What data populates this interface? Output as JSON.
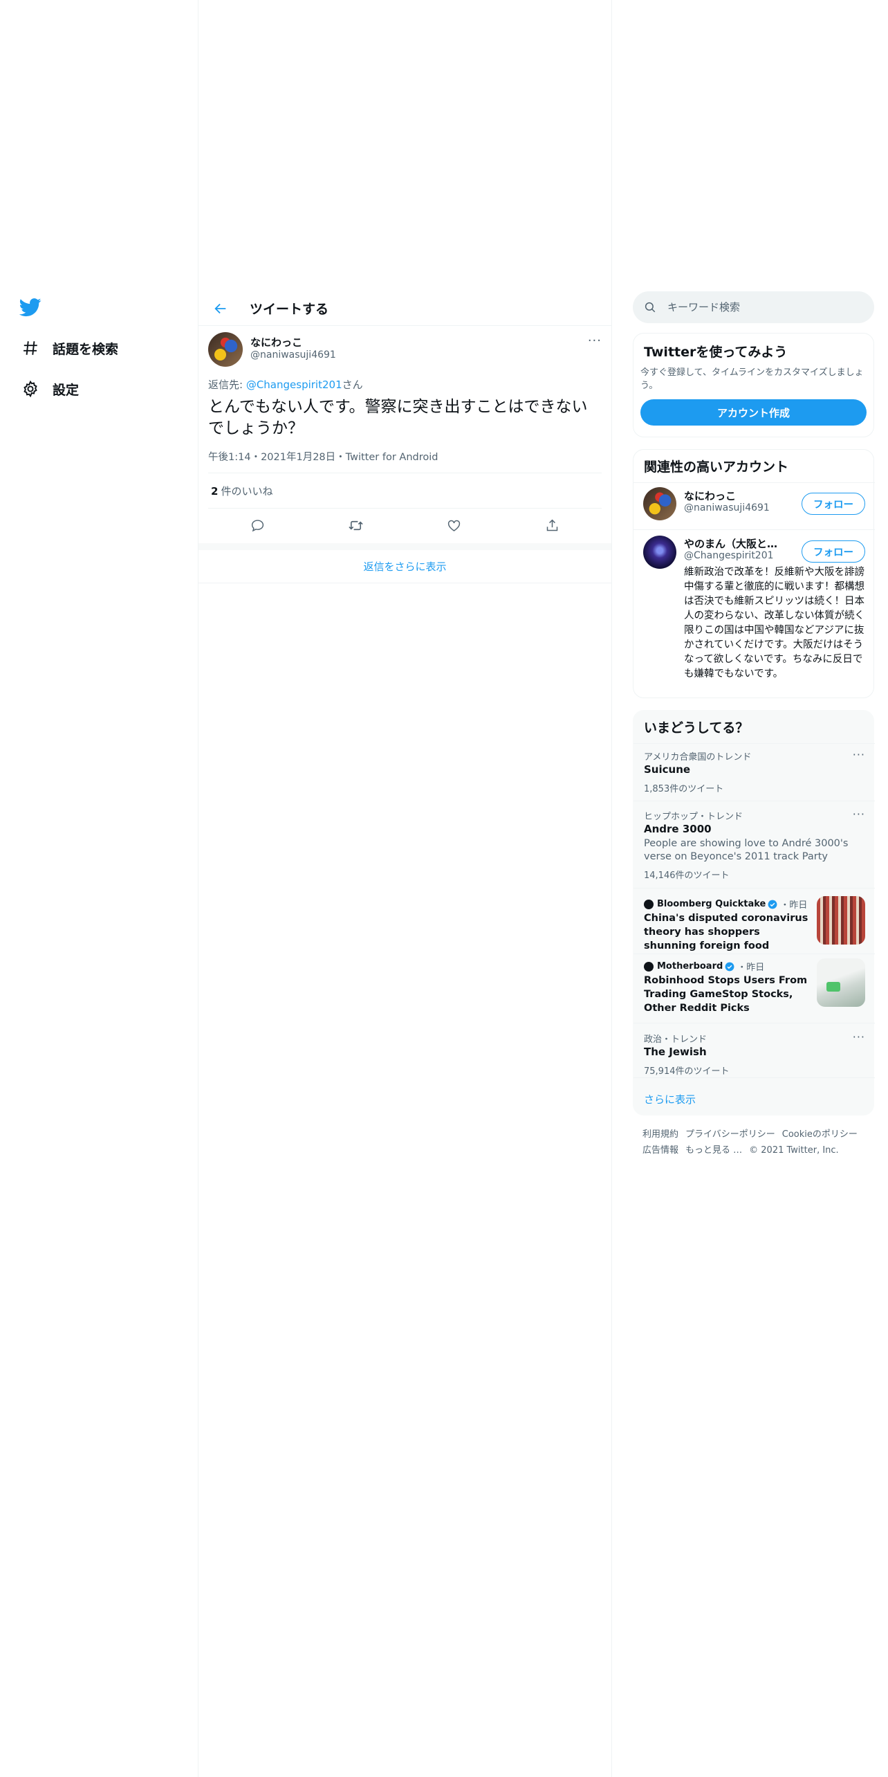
{
  "nav": {
    "explore_label": "話題を検索",
    "settings_label": "設定"
  },
  "header": {
    "title": "ツイートする"
  },
  "tweet": {
    "display_name": "なにわっこ",
    "handle": "@naniwasuji4691",
    "reply_prefix": "返信先: ",
    "reply_mention": "@Changespirit201",
    "reply_suffix": "さん",
    "text": "とんでもない人です。警察に突き出すことはできないでしょうか？",
    "time": "午後1:14",
    "date": "2021年1月28日",
    "source": "Twitter for Android",
    "meta_sep": "・",
    "like_count": "2",
    "like_label": "件のいいね",
    "show_more_replies": "返信をさらに表示"
  },
  "search": {
    "placeholder": "キーワード検索"
  },
  "signup": {
    "title": "Twitterを使ってみよう",
    "description": "今すぐ登録して、タイムラインをカスタマイズしましょう。",
    "button": "アカウント作成"
  },
  "relevant": {
    "title": "関連性の高いアカウント",
    "follow_label": "フォロー",
    "accounts": [
      {
        "name": "なにわっこ",
        "handle": "@naniwasuji4691",
        "bio": ""
      },
      {
        "name": "やのまん（大阪と維...",
        "handle": "@Changespirit201",
        "bio": "維新政治で改革を！反維新や大阪を誹謗中傷する輩と徹底的に戦います！都構想は否決でも維新スピリッツは続く！日本人の変わらない、改革しない体質が続く限りこの国は中国や韓国などアジアに抜かされていくだけです。大阪だけはそうなって欲しくないです。ちなみに反日でも嫌韓でもないです。"
      }
    ]
  },
  "trends": {
    "title": "いまどうしてる？",
    "items": [
      {
        "context": "アメリカ合衆国のトレンド",
        "name": "Suicune",
        "description": "",
        "count": "1,853件のツイート"
      },
      {
        "context": "ヒップホップ・トレンド",
        "name": "Andre 3000",
        "description": "People are showing love to André 3000's verse on Beyonce's 2011 track Party",
        "count": "14,146件のツイート"
      },
      {
        "context": "政治・トレンド",
        "name": "The Jewish",
        "description": "",
        "count": "75,914件のツイート"
      }
    ],
    "news": [
      {
        "source": "Bloomberg Quicktake",
        "time": "・昨日",
        "headline": "China's disputed coronavirus theory has shoppers shunning foreign food"
      },
      {
        "source": "Motherboard",
        "time": "・昨日",
        "headline": "Robinhood Stops Users From Trading GameStop Stocks, Other Reddit Picks"
      }
    ],
    "show_more": "さらに表示"
  },
  "footer": {
    "links": [
      "利用規約",
      "プライバシーポリシー",
      "Cookieのポリシー",
      "広告情報",
      "もっと見る …"
    ],
    "copyright": "© 2021 Twitter, Inc."
  },
  "colors": {
    "accent": "#1d9bf0",
    "text": "#0f1419",
    "muted": "#536471",
    "border": "#eff3f4"
  }
}
